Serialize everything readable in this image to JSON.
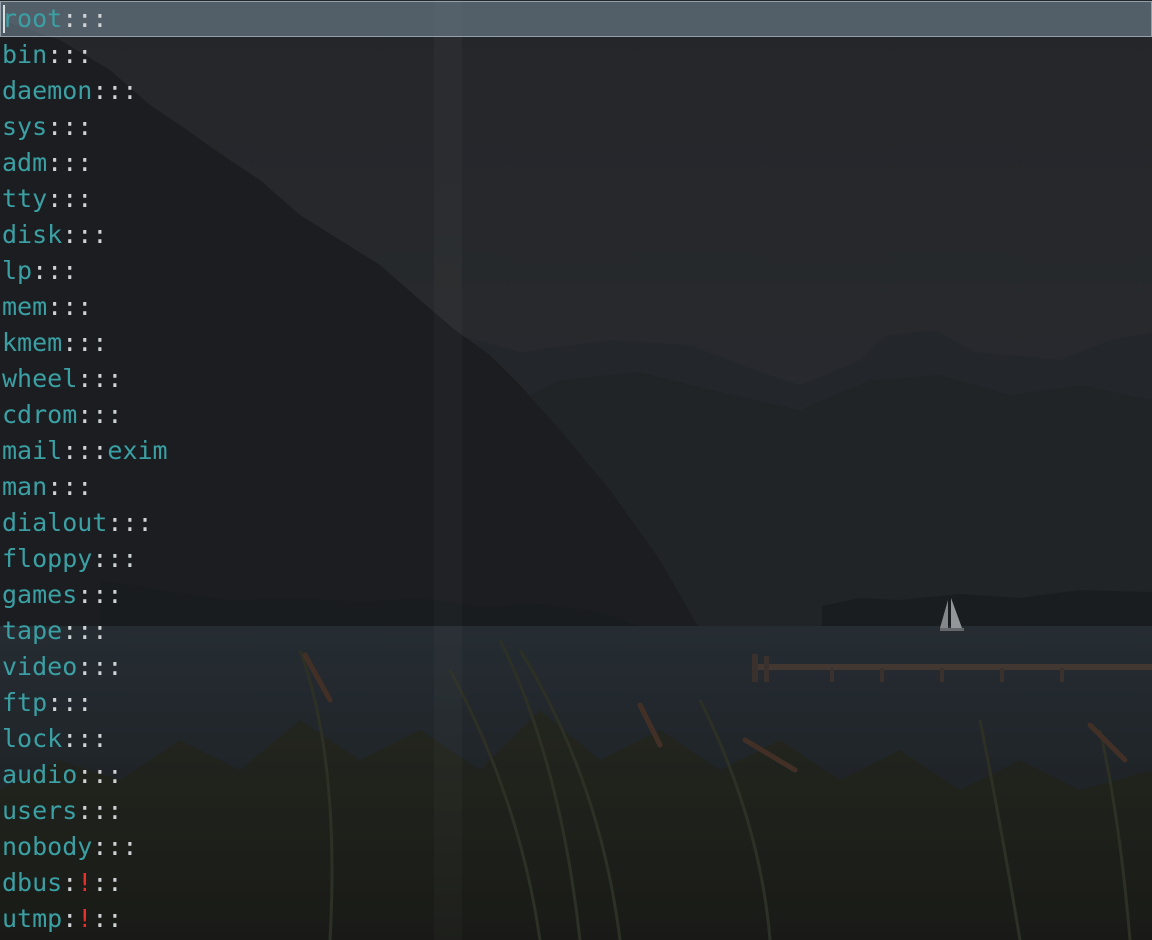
{
  "window": {
    "cursor_line": 1
  },
  "colors": {
    "group_name": "#3aa0a4",
    "separator": "#cfd3d6",
    "locked_password": "#e8312a",
    "members": "#3aa0a4",
    "current_line_highlight": "#788c9b"
  },
  "lines": [
    {
      "name": "root",
      "pw": "",
      "rest": "::",
      "members": ""
    },
    {
      "name": "bin",
      "pw": "",
      "rest": "::",
      "members": ""
    },
    {
      "name": "daemon",
      "pw": "",
      "rest": "::",
      "members": ""
    },
    {
      "name": "sys",
      "pw": "",
      "rest": "::",
      "members": ""
    },
    {
      "name": "adm",
      "pw": "",
      "rest": "::",
      "members": ""
    },
    {
      "name": "tty",
      "pw": "",
      "rest": "::",
      "members": ""
    },
    {
      "name": "disk",
      "pw": "",
      "rest": "::",
      "members": ""
    },
    {
      "name": "lp",
      "pw": "",
      "rest": "::",
      "members": ""
    },
    {
      "name": "mem",
      "pw": "",
      "rest": "::",
      "members": ""
    },
    {
      "name": "kmem",
      "pw": "",
      "rest": "::",
      "members": ""
    },
    {
      "name": "wheel",
      "pw": "",
      "rest": "::",
      "members": ""
    },
    {
      "name": "cdrom",
      "pw": "",
      "rest": "::",
      "members": ""
    },
    {
      "name": "mail",
      "pw": "",
      "rest": "::",
      "members": "exim"
    },
    {
      "name": "man",
      "pw": "",
      "rest": "::",
      "members": ""
    },
    {
      "name": "dialout",
      "pw": "",
      "rest": "::",
      "members": ""
    },
    {
      "name": "floppy",
      "pw": "",
      "rest": "::",
      "members": ""
    },
    {
      "name": "games",
      "pw": "",
      "rest": "::",
      "members": ""
    },
    {
      "name": "tape",
      "pw": "",
      "rest": "::",
      "members": ""
    },
    {
      "name": "video",
      "pw": "",
      "rest": "::",
      "members": ""
    },
    {
      "name": "ftp",
      "pw": "",
      "rest": "::",
      "members": ""
    },
    {
      "name": "lock",
      "pw": "",
      "rest": "::",
      "members": ""
    },
    {
      "name": "audio",
      "pw": "",
      "rest": "::",
      "members": ""
    },
    {
      "name": "users",
      "pw": "",
      "rest": "::",
      "members": ""
    },
    {
      "name": "nobody",
      "pw": "",
      "rest": "::",
      "members": ""
    },
    {
      "name": "dbus",
      "pw": "!",
      "rest": "::",
      "members": ""
    },
    {
      "name": "utmp",
      "pw": "!",
      "rest": "::",
      "members": ""
    }
  ]
}
